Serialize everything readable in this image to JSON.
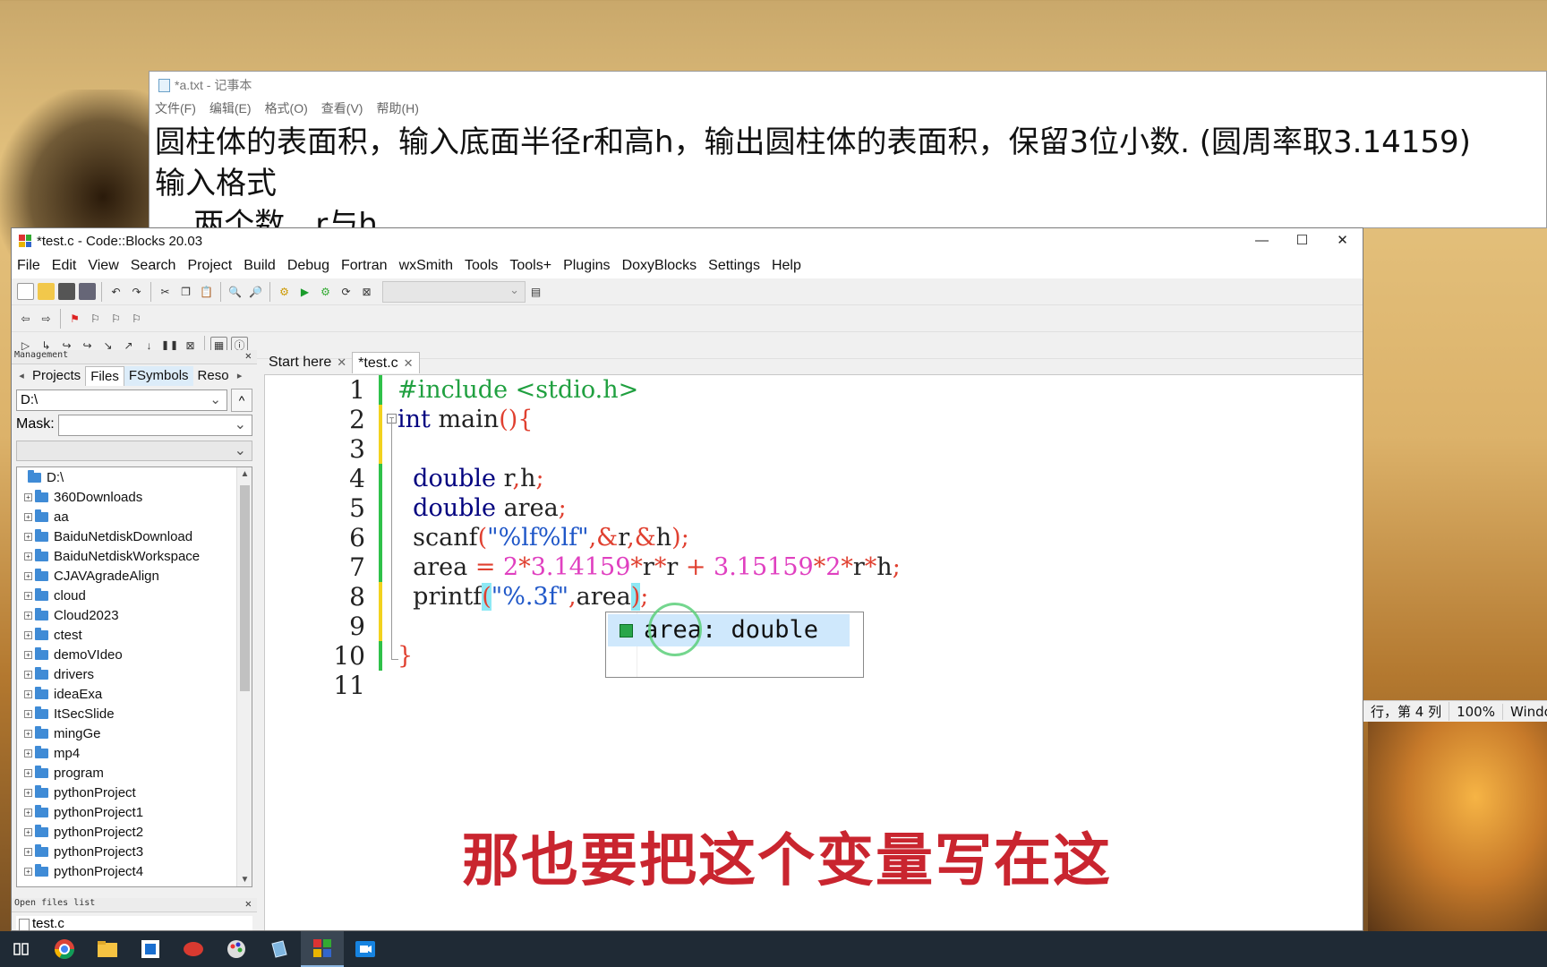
{
  "notepad": {
    "title": "*a.txt - 记事本",
    "menu": [
      "文件(F)",
      "编辑(E)",
      "格式(O)",
      "查看(V)",
      "帮助(H)"
    ],
    "lines": [
      "圆柱体的表面积，输入底面半径r和高h，输出圆柱体的表面积，保留3位小数. (圆周率取3.14159)",
      "输入格式",
      "    两个数，r与h"
    ]
  },
  "codeblocks": {
    "title": "*test.c - Code::Blocks 20.03",
    "window_controls": {
      "minimize": "—",
      "maximize": "☐",
      "close": "✕"
    },
    "menu": [
      "File",
      "Edit",
      "View",
      "Search",
      "Project",
      "Build",
      "Debug",
      "Fortran",
      "wxSmith",
      "Tools",
      "Tools+",
      "Plugins",
      "DoxyBlocks",
      "Settings",
      "Help"
    ],
    "management": {
      "header": "Management",
      "tabs": [
        "Projects",
        "Files",
        "FSymbols",
        "Reso"
      ],
      "dir": "D:\\",
      "up_button": "^",
      "mask_label": "Mask:",
      "mask_value": "",
      "tree_root": "D:\\",
      "tree_items": [
        "360Downloads",
        "aa",
        "BaiduNetdiskDownload",
        "BaiduNetdiskWorkspace",
        "CJAVAgradeAlign",
        "cloud",
        "Cloud2023",
        "ctest",
        "demoVIdeo",
        "drivers",
        "ideaExa",
        "ItSecSlide",
        "mingGe",
        "mp4",
        "program",
        "pythonProject",
        "pythonProject1",
        "pythonProject2",
        "pythonProject3",
        "pythonProject4"
      ]
    },
    "open_files": {
      "header": "Open files list",
      "files": [
        "test.c"
      ]
    },
    "editor_tabs": [
      "Start here",
      "*test.c"
    ],
    "line_numbers": [
      "1",
      "2",
      "3",
      "4",
      "5",
      "6",
      "7",
      "8",
      "9",
      "10",
      "11"
    ],
    "autocomplete": "area: double",
    "status": [
      "行，第 4 列",
      "100%",
      "Windo"
    ]
  },
  "subtitle": "那也要把这个变量写在这",
  "colors": {
    "accent": "#c9252f",
    "keyword": "#00007f",
    "preprocessor": "#20a040",
    "number": "#e040c0",
    "string": "#1f57c8",
    "brace_highlight": "#8ee8f4"
  }
}
